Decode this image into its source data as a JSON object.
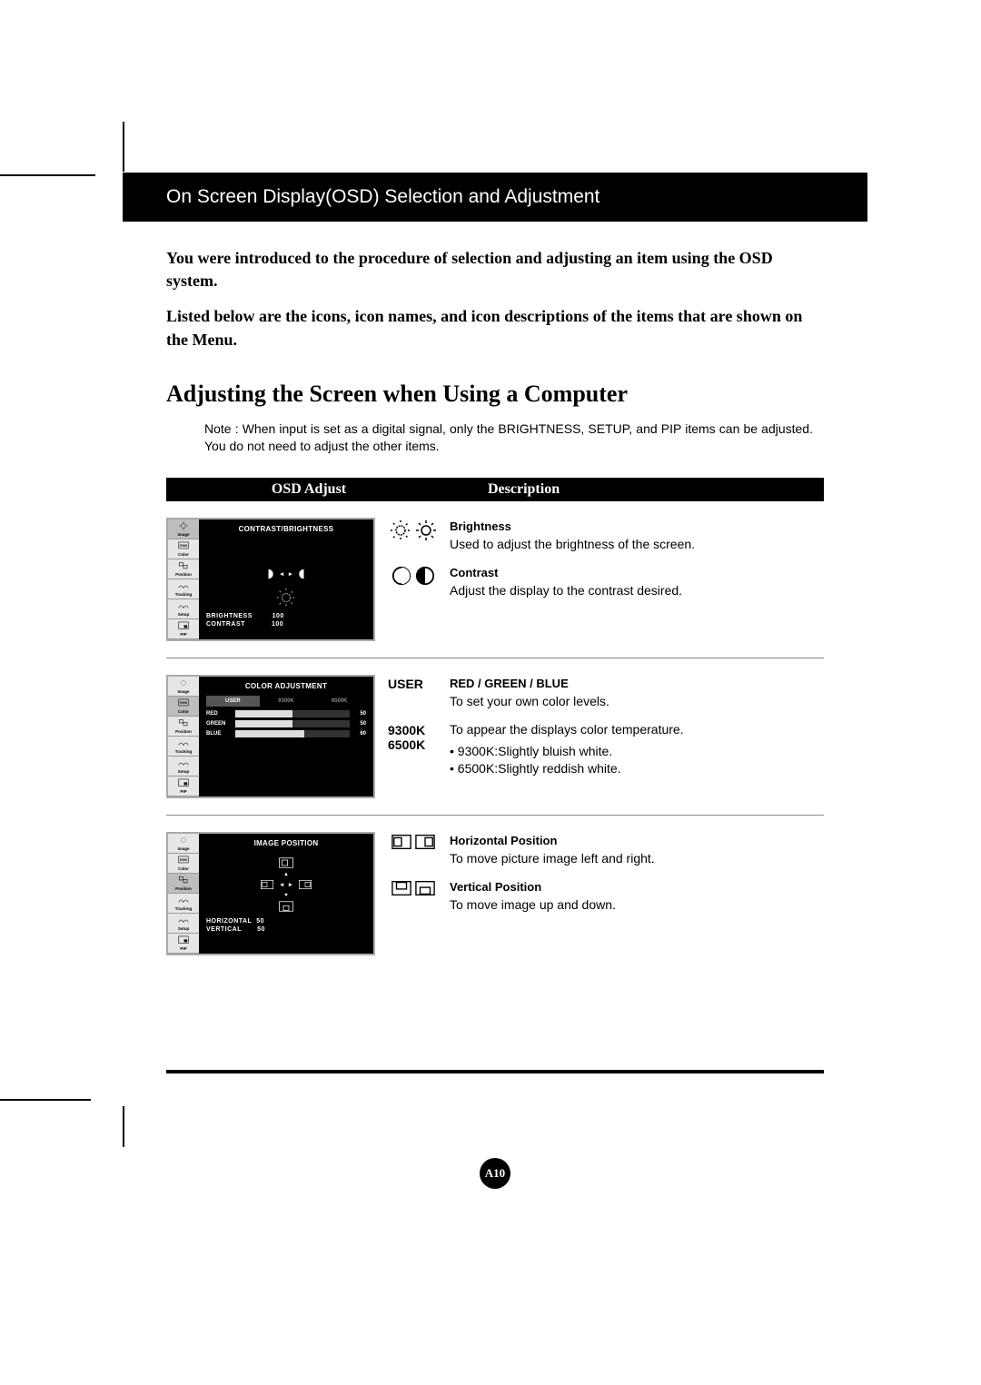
{
  "header_title": "On Screen Display(OSD) Selection and Adjustment",
  "intro": {
    "p1": "You were introduced to the procedure of selection and adjusting an item using the OSD system.",
    "p2": "Listed below are the icons, icon names, and icon descriptions of the items that are shown on the Menu."
  },
  "section_heading": "Adjusting the Screen when Using a Computer",
  "note": "Note : When input is set as a digital signal, only the BRIGHTNESS, SETUP, and PIP items can be adjusted. You do not need to adjust the other items.",
  "columns": {
    "osd": "OSD Adjust",
    "desc": "Description"
  },
  "osd_side_labels": [
    "Image",
    "Color",
    "Position",
    "Tracking",
    "Setup",
    "PIP"
  ],
  "panel1": {
    "title": "CONTRAST/BRIGHTNESS",
    "readout": [
      {
        "label": "BRIGHTNESS",
        "value": "100"
      },
      {
        "label": "CONTRAST",
        "value": "100"
      }
    ]
  },
  "panel2": {
    "title": "COLOR ADJUSTMENT",
    "tabs": [
      "USER",
      "9300K",
      "6500K"
    ],
    "rows": [
      {
        "label": "RED",
        "value": "50",
        "pct": 50
      },
      {
        "label": "GREEN",
        "value": "50",
        "pct": 50
      },
      {
        "label": "BLUE",
        "value": "60",
        "pct": 60
      }
    ]
  },
  "panel3": {
    "title": "IMAGE POSITION",
    "readout": [
      {
        "label": "HORIZONTAL",
        "value": "50"
      },
      {
        "label": "VERTICAL",
        "value": "50"
      }
    ]
  },
  "desc1": {
    "brightness_title": "Brightness",
    "brightness_body": "Used to adjust the brightness of the screen.",
    "contrast_title": "Contrast",
    "contrast_body": "Adjust the display to the contrast desired."
  },
  "desc2": {
    "user_label": "USER",
    "rgb_title": "RED / GREEN / BLUE",
    "rgb_body": "To set your own color levels.",
    "temp_label1": "9300K",
    "temp_label2": "6500K",
    "temp_body": "To appear the displays color temperature.",
    "bullet1": "9300K:Slightly bluish white.",
    "bullet2": "6500K:Slightly reddish white."
  },
  "desc3": {
    "hpos_title": "Horizontal Position",
    "hpos_body": "To move picture image left and right.",
    "vpos_title": "Vertical Position",
    "vpos_body": "To move image up and down."
  },
  "page_number": "A10"
}
